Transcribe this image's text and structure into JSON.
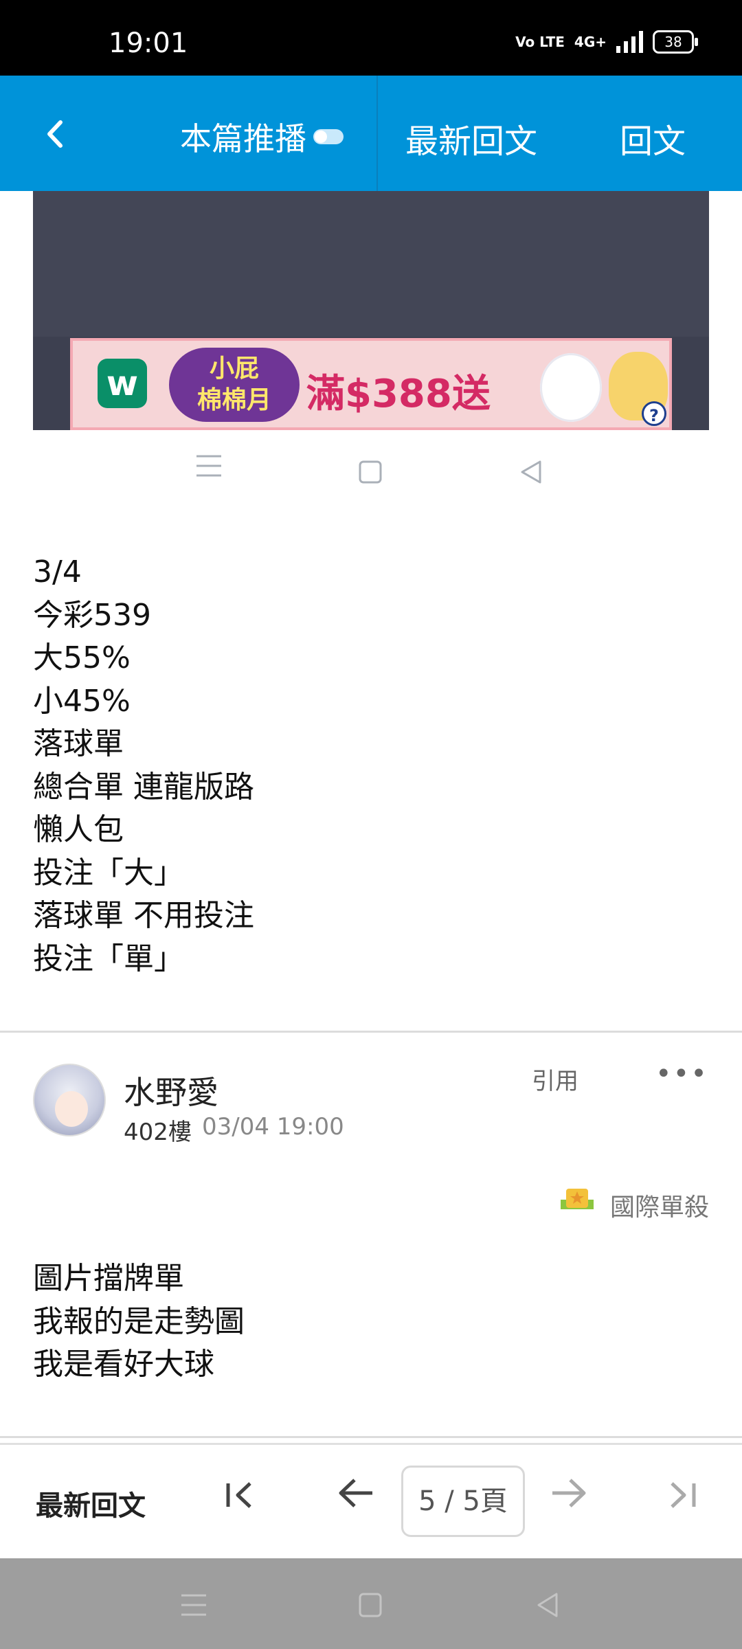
{
  "status_bar": {
    "time": "19:01",
    "volte": "Vo LTE",
    "network": "4G+",
    "battery": "38"
  },
  "top_nav": {
    "push_label": "本篇推播",
    "latest_label": "最新回文",
    "reply_label": "回文"
  },
  "ad": {
    "logo_letter": "w",
    "title_line1": "小屁",
    "title_line2": "棉棉月",
    "promo_text": "滿$388送",
    "help": "?"
  },
  "post_1": {
    "lines": [
      "3/4",
      "今彩539",
      "大55%",
      "小45%",
      "落球單",
      "總合單 連龍版路",
      "懶人包",
      "投注「大」",
      "落球單 不用投注",
      "投注「單」"
    ]
  },
  "post_2": {
    "username": "水野愛",
    "floor": "402樓",
    "timestamp": "03/04 19:00",
    "quote_label": "引用",
    "more_label": "•••",
    "badge": "國際單殺",
    "lines": [
      "圖片擋牌單",
      "我報的是走勢圖",
      "我是看好大球"
    ]
  },
  "pager": {
    "latest_label": "最新回文",
    "first_icon": "|<",
    "prev_icon": "←",
    "page_text": "5 / 5頁",
    "next_icon": "→",
    "last_icon": ">|"
  }
}
